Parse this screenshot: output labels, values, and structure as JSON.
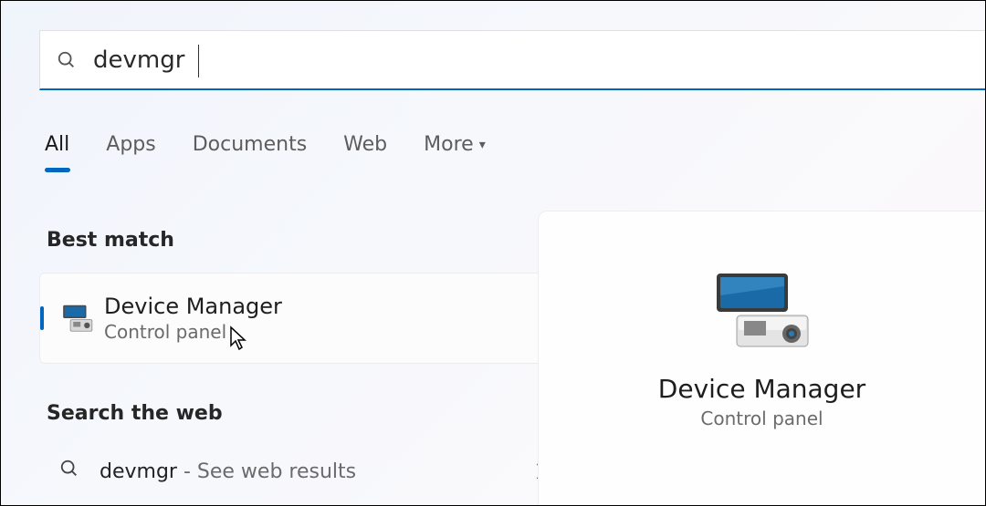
{
  "search": {
    "query": "devmgr"
  },
  "tabs": {
    "all": "All",
    "apps": "Apps",
    "documents": "Documents",
    "web": "Web",
    "more": "More"
  },
  "sections": {
    "best_match": "Best match",
    "search_web": "Search the web"
  },
  "best_match": {
    "title": "Device Manager",
    "subtitle": "Control panel"
  },
  "web_result": {
    "query": "devmgr",
    "desc": " - See web results"
  },
  "preview": {
    "title": "Device Manager",
    "subtitle": "Control panel"
  }
}
